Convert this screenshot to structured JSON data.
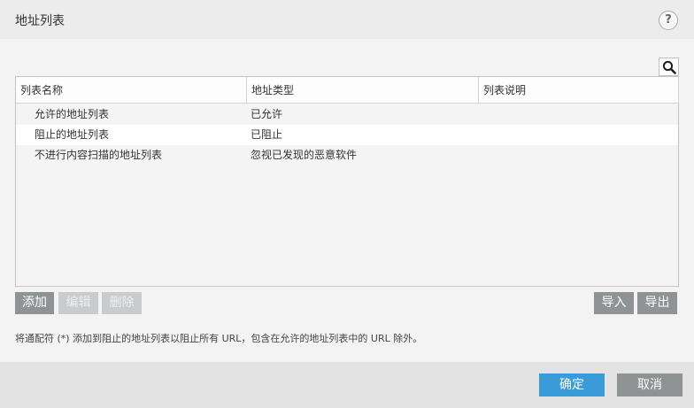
{
  "dialog": {
    "title": "地址列表",
    "help_label": "?"
  },
  "table": {
    "columns": [
      "列表名称",
      "地址类型",
      "列表说明"
    ],
    "rows": [
      {
        "name": "允许的地址列表",
        "type": "已允许",
        "description": ""
      },
      {
        "name": "阻止的地址列表",
        "type": "已阻止",
        "description": ""
      },
      {
        "name": "不进行内容扫描的地址列表",
        "type": "忽视已发现的恶意软件",
        "description": ""
      }
    ]
  },
  "toolbar": {
    "add_label": "添加",
    "edit_label": "编辑",
    "delete_label": "删除",
    "import_label": "导入",
    "export_label": "导出"
  },
  "note": "将通配符 (*) 添加到阻止的地址列表以阻止所有 URL，包含在允许的地址列表中的 URL 除外。",
  "footer": {
    "ok_label": "确定",
    "cancel_label": "取消"
  },
  "colors": {
    "primary_button": "#3a9bd9",
    "secondary_button": "#8f9394",
    "disabled_button": "#c9cbcc"
  },
  "icons": {
    "search": "search-icon",
    "help": "help-icon"
  }
}
